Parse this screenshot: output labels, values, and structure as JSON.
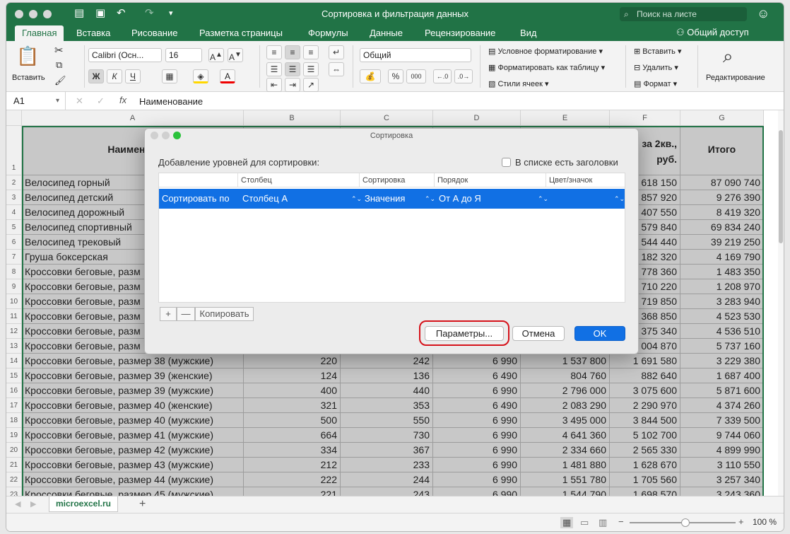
{
  "titlebar": {
    "title": "Сортировка и фильтрация данных",
    "search_placeholder": "Поиск на листе"
  },
  "tabs": [
    "Главная",
    "Вставка",
    "Рисование",
    "Разметка страницы",
    "Формулы",
    "Данные",
    "Рецензирование",
    "Вид"
  ],
  "share_label": "Общий доступ",
  "ribbon": {
    "paste_label": "Вставить",
    "font_name": "Calibri (Осн...",
    "font_size": "16",
    "bold": "Ж",
    "italic": "К",
    "underline": "Ч",
    "number_format": "Общий",
    "cond_format": "Условное форматирование",
    "format_table": "Форматировать как таблицу",
    "cell_styles": "Стили ячеек",
    "insert": "Вставить",
    "delete": "Удалить",
    "format": "Формат",
    "editing": "Редактирование"
  },
  "formula_bar": {
    "cell_ref": "A1",
    "fx": "fx",
    "content": "Наименование"
  },
  "columns": [
    "A",
    "B",
    "C",
    "D",
    "E",
    "F",
    "G"
  ],
  "sheet": {
    "header_a": "Наименов",
    "header_f": "за 2кв.,\nруб.",
    "header_f1": "за 2кв.,",
    "header_f2": "руб.",
    "header_g": "Итого",
    "rows": [
      {
        "n": "2",
        "a": "Велосипед горный",
        "f": "618 150",
        "g": "87 090 740"
      },
      {
        "n": "3",
        "a": "Велосипед детский",
        "f": "857 920",
        "g": "9 276 390"
      },
      {
        "n": "4",
        "a": "Велосипед дорожный",
        "f": "407 550",
        "g": "8 419 320"
      },
      {
        "n": "5",
        "a": "Велосипед спортивный",
        "f": "579 840",
        "g": "69 834 240"
      },
      {
        "n": "6",
        "a": "Велосипед трековый",
        "f": "544 440",
        "g": "39 219 250"
      },
      {
        "n": "7",
        "a": "Груша боксерская",
        "f": "182 320",
        "g": "4 169 790"
      },
      {
        "n": "8",
        "a": "Кроссовки беговые, разм",
        "f": "778 360",
        "g": "1 483 350"
      },
      {
        "n": "9",
        "a": "Кроссовки беговые, разм",
        "f": "710 220",
        "g": "1 208 970"
      },
      {
        "n": "10",
        "a": "Кроссовки беговые, разм",
        "f": "719 850",
        "g": "3 283 940"
      },
      {
        "n": "11",
        "a": "Кроссовки беговые, разм",
        "f": "368 850",
        "g": "4 523 530"
      },
      {
        "n": "12",
        "a": "Кроссовки беговые, разм",
        "f": "375 340",
        "g": "4 536 510"
      },
      {
        "n": "13",
        "a": "Кроссовки беговые, разм",
        "f": "004 870",
        "g": "5 737 160"
      },
      {
        "n": "14",
        "a": "Кроссовки беговые, размер 38 (мужские)",
        "b": "220",
        "c": "242",
        "d": "6 990",
        "e": "1 537 800",
        "f": "1 691 580",
        "g": "3 229 380"
      },
      {
        "n": "15",
        "a": "Кроссовки беговые, размер 39 (женские)",
        "b": "124",
        "c": "136",
        "d": "6 490",
        "e": "804 760",
        "f": "882 640",
        "g": "1 687 400"
      },
      {
        "n": "16",
        "a": "Кроссовки беговые, размер 39 (мужские)",
        "b": "400",
        "c": "440",
        "d": "6 990",
        "e": "2 796 000",
        "f": "3 075 600",
        "g": "5 871 600"
      },
      {
        "n": "17",
        "a": "Кроссовки беговые, размер 40 (женские)",
        "b": "321",
        "c": "353",
        "d": "6 490",
        "e": "2 083 290",
        "f": "2 290 970",
        "g": "4 374 260"
      },
      {
        "n": "18",
        "a": "Кроссовки беговые, размер 40 (мужские)",
        "b": "500",
        "c": "550",
        "d": "6 990",
        "e": "3 495 000",
        "f": "3 844 500",
        "g": "7 339 500"
      },
      {
        "n": "19",
        "a": "Кроссовки беговые, размер 41 (мужские)",
        "b": "664",
        "c": "730",
        "d": "6 990",
        "e": "4 641 360",
        "f": "5 102 700",
        "g": "9 744 060"
      },
      {
        "n": "20",
        "a": "Кроссовки беговые, размер 42 (мужские)",
        "b": "334",
        "c": "367",
        "d": "6 990",
        "e": "2 334 660",
        "f": "2 565 330",
        "g": "4 899 990"
      },
      {
        "n": "21",
        "a": "Кроссовки беговые, размер 43 (мужские)",
        "b": "212",
        "c": "233",
        "d": "6 990",
        "e": "1 481 880",
        "f": "1 628 670",
        "g": "3 110 550"
      },
      {
        "n": "22",
        "a": "Кроссовки беговые, размер 44 (мужские)",
        "b": "222",
        "c": "244",
        "d": "6 990",
        "e": "1 551 780",
        "f": "1 705 560",
        "g": "3 257 340"
      },
      {
        "n": "23",
        "a": "Кроссовки беговые, размер 45 (мужские)",
        "b": "221",
        "c": "243",
        "d": "6 990",
        "e": "1 544 790",
        "f": "1 698 570",
        "g": "3 243 360"
      }
    ]
  },
  "sheet_tab": "microexcel.ru",
  "zoom": "100 %",
  "dialog": {
    "title": "Сортировка",
    "levels_label": "Добавление уровней для сортировки:",
    "headers_checkbox": "В списке есть заголовки",
    "col_headers": [
      "Столбец",
      "Сортировка",
      "Порядок",
      "Цвет/значок"
    ],
    "row": {
      "label": "Сортировать по",
      "column": "Столбец A",
      "sort_on": "Значения",
      "order": "От А до Я"
    },
    "add": "+",
    "remove": "—",
    "copy": "Копировать",
    "options": "Параметры...",
    "cancel": "Отмена",
    "ok": "OK"
  }
}
